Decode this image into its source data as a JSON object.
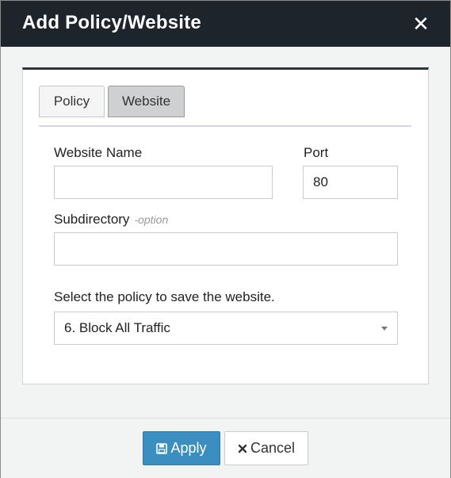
{
  "dialog": {
    "title": "Add Policy/Website",
    "close_glyph": "✕"
  },
  "tabs": [
    {
      "label": "Policy",
      "active": false
    },
    {
      "label": "Website",
      "active": true
    }
  ],
  "form": {
    "website_name": {
      "label": "Website Name",
      "value": ""
    },
    "port": {
      "label": "Port",
      "value": "80"
    },
    "subdirectory": {
      "label": "Subdirectory",
      "hint": "-option",
      "value": ""
    },
    "policy_select": {
      "label": "Select the policy to save the website.",
      "selected": "6. Block All Traffic"
    }
  },
  "buttons": {
    "apply": {
      "label": "Apply",
      "icon": "save-icon"
    },
    "cancel": {
      "label": "Cancel",
      "icon": "times-icon"
    }
  },
  "colors": {
    "titlebar": "#1d242b",
    "apply_button": "#3a8fc0",
    "active_tab": "#cfd0d1"
  }
}
